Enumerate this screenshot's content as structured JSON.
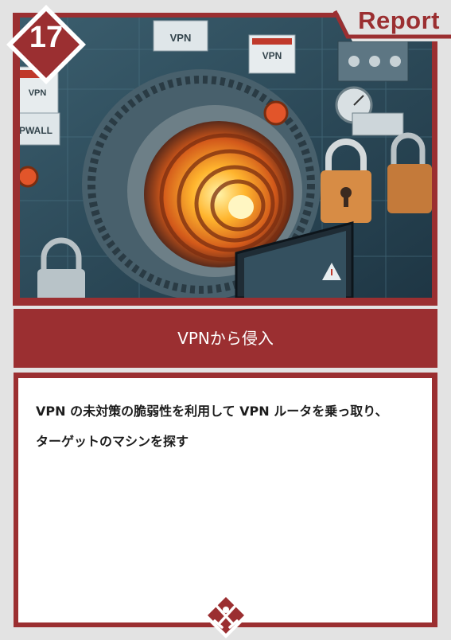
{
  "card": {
    "number": "17",
    "category": "Report",
    "title": "VPNから侵入",
    "description_lines": [
      "VPN の未対策の脆弱性を利用して VPN ルータを乗っ取り、",
      "ターゲットのマシンを探す"
    ]
  },
  "illustration": {
    "signs": [
      "VPN",
      "VPN",
      "VPN",
      "PWALL"
    ]
  },
  "colors": {
    "accent": "#9b2f31",
    "background": "#e3e3e3",
    "panel": "#ffffff"
  },
  "icons": [
    "crossed-swords-emblem-icon"
  ]
}
